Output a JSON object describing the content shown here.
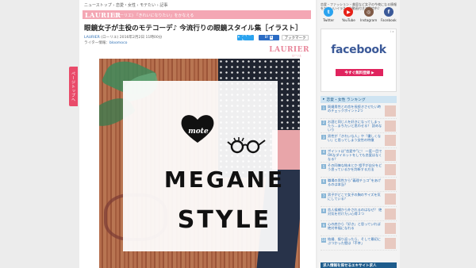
{
  "side_tab": {
    "label": "ページトップへ"
  },
  "breadcrumb": [
    "ニューストップ",
    "恋愛・女性",
    "モテたい",
    "記事"
  ],
  "brand": {
    "logo": "LAURIER",
    "tagline": "(ローリエ) 「きれいになりたい」をかなえる"
  },
  "article": {
    "title": "眼鏡女子が主役のモテコーデ♪ 今流行りの眼鏡スタイル集［イラスト］",
    "source": "LAURIER",
    "source_paren": "(ローリエ)",
    "date": "2016年2月2日 11時00分",
    "writer_label": "ライター情報：",
    "writer_name": "bloomoco"
  },
  "share": {
    "tweet": "ツイート",
    "hatena": "B!",
    "hatena_count": "6",
    "facebook": "ブックマーク"
  },
  "laurier_mark": {
    "main": "LAURIER",
    "sub": "ローリエ"
  },
  "hero": {
    "heart_text": "mote",
    "line1": "MEGANE",
    "line2": "STYLE"
  },
  "sidebar": {
    "top_text": "恋愛・ファッション・美容など女子の今夜になる情報をかわいいイラストや動画付きで発信中♪",
    "sns": [
      {
        "label": "Twitter",
        "icon": "twitter-icon",
        "color": "#2aa3ef",
        "glyph": "t"
      },
      {
        "label": "YouTube",
        "icon": "youtube-icon",
        "color": "#e62117",
        "glyph": "▶"
      },
      {
        "label": "Instagram",
        "icon": "instagram-icon",
        "color": "#7f5a46",
        "glyph": "◎"
      },
      {
        "label": "Facebook",
        "icon": "facebook-icon",
        "color": "#3b5998",
        "glyph": "f"
      }
    ],
    "ad": {
      "logo": "facebook",
      "button": "今すぐ無料登録 ▶",
      "info": "i ×"
    },
    "ranking_head": "恋愛・女性 ランキング",
    "ranking": [
      {
        "num": "1",
        "title": "既婚男性との恋を長続きさせたい時のチェックポイント2つ"
      },
      {
        "num": "2",
        "title": "お酒と同じ人を好きになってしまったら…まちたいと思わせる？ 読めないり"
      },
      {
        "num": "3",
        "title": "男性が「きれいな人」や「優しくない」と思ってしまう女性の特徴"
      },
      {
        "num": "4",
        "title": "ポイントは“恋愛中”に！ 一度一目でOKなダイエットをしても恋愛はなくなる？"
      },
      {
        "num": "5",
        "title": "その同僚な結末とか 相手が自分をどう思っているかを判断する方法"
      },
      {
        "num": "6",
        "title": "職場の男性から“義理チョコ”をあげるのは本当？"
      },
      {
        "num": "7",
        "title": "男子がどこで女子の胸のサイズを気にしている？"
      },
      {
        "num": "8",
        "title": "恋人候補から外されるのはなぜ？ 絶対気を付けたい心得３つ"
      },
      {
        "num": "9",
        "title": "心の底から「好き」と思っていれば絶対幸福になれる"
      },
      {
        "num": "10",
        "title": "結婚、振り返ったら、そして最初にぶつかった壁は「不幸」"
      }
    ],
    "ranking_footer": "求人情報を探せるエキサイト求人"
  }
}
